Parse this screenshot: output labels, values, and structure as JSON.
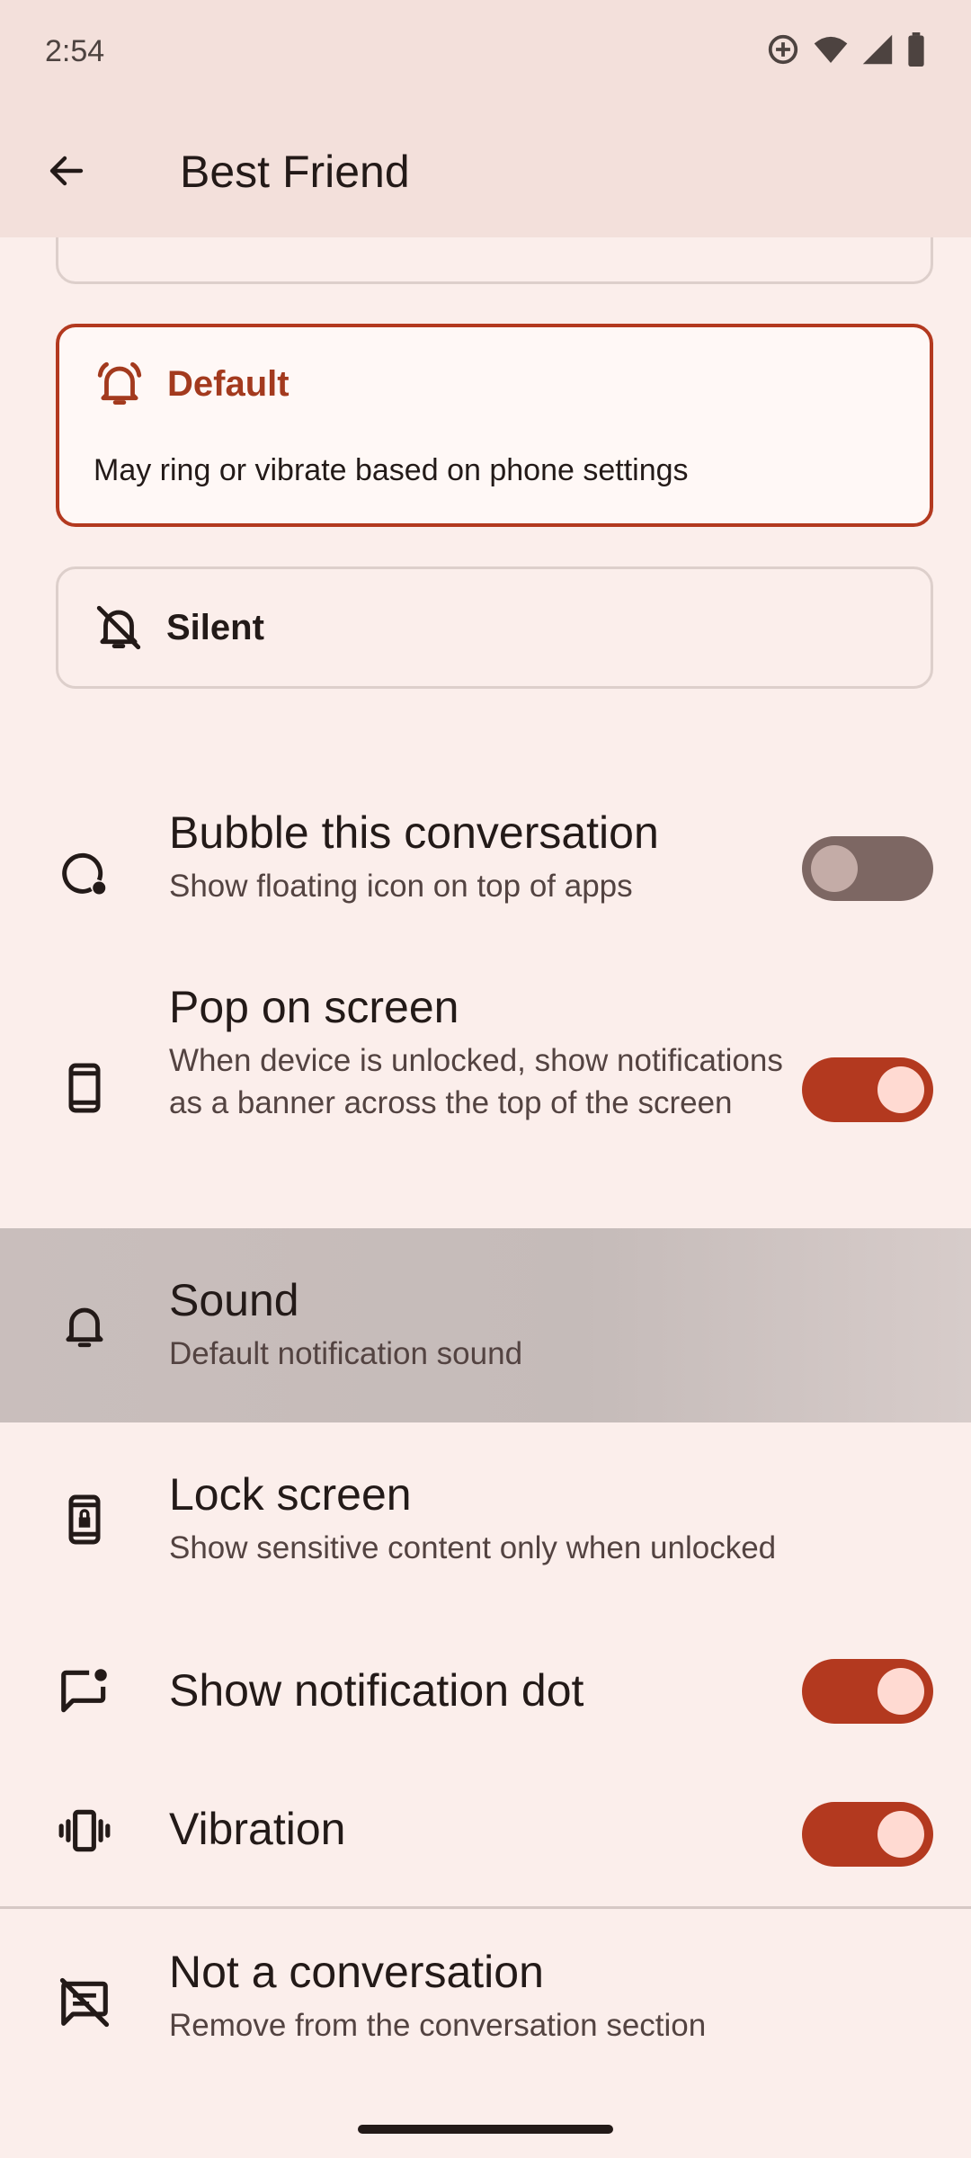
{
  "status_bar": {
    "time": "2:54"
  },
  "app_bar": {
    "title": "Best Friend"
  },
  "priority_options": {
    "default": {
      "label": "Default",
      "description": "May ring or vibrate based on phone settings"
    },
    "silent": {
      "label": "Silent"
    }
  },
  "settings": {
    "bubble": {
      "title": "Bubble this conversation",
      "subtitle": "Show floating icon on top of apps",
      "toggle": false
    },
    "pop": {
      "title": "Pop on screen",
      "subtitle": "When device is unlocked, show notifications as a banner across the top of the screen",
      "toggle": true
    },
    "sound": {
      "title": "Sound",
      "subtitle": "Default notification sound"
    },
    "lock": {
      "title": "Lock screen",
      "subtitle": "Show sensitive content only when unlocked"
    },
    "dot": {
      "title": "Show notification dot",
      "toggle": true
    },
    "vibration": {
      "title": "Vibration",
      "toggle": true
    },
    "not_conversation": {
      "title": "Not a conversation",
      "subtitle": "Remove from the conversation section"
    }
  },
  "colors": {
    "accent": "#b3391f",
    "background": "#fbeeeb",
    "appbar": "#f3e0db"
  }
}
